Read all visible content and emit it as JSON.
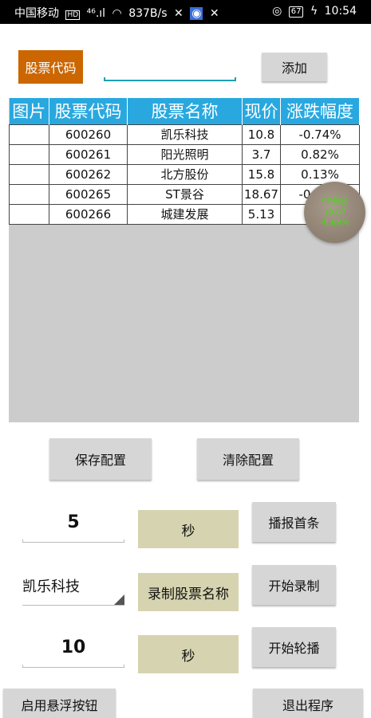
{
  "status_bar": {
    "carrier": "中国移动",
    "network": "⁴⁶.ıl",
    "speed": "837B/s",
    "battery": "67",
    "time": "10:54"
  },
  "top": {
    "code_label": "股票代码",
    "code_input_value": "",
    "add_button": "添加"
  },
  "table": {
    "headers": [
      "图片",
      "股票代码",
      "股票名称",
      "现价",
      "涨跌幅度"
    ],
    "rows": [
      {
        "image": "",
        "code": "600260",
        "name": "凯乐科技",
        "price": "10.8",
        "change": "-0.74%"
      },
      {
        "image": "",
        "code": "600261",
        "name": "阳光照明",
        "price": "3.7",
        "change": "0.82%"
      },
      {
        "image": "",
        "code": "600262",
        "name": "北方股份",
        "price": "15.8",
        "change": "0.13%"
      },
      {
        "image": "",
        "code": "600265",
        "name": "ST景谷",
        "price": "18.67",
        "change": "-0.69%"
      },
      {
        "image": "",
        "code": "600266",
        "name": "城建发展",
        "price": "5.13",
        "change": "0."
      }
    ]
  },
  "floating": {
    "name": "ST景谷",
    "price": "18.67",
    "change": "-0.69%",
    "text_color": "#39e600"
  },
  "config": {
    "save_button": "保存配置",
    "clear_button": "清除配置"
  },
  "controls": {
    "interval_value": "5",
    "interval_unit": "秒",
    "announce_first_button": "播报首条",
    "stock_select_value": "凯乐科技",
    "record_name_label": "录制股票名称",
    "start_record_button": "开始录制",
    "carousel_value": "10",
    "carousel_unit": "秒",
    "start_carousel_button": "开始轮播"
  },
  "bottom": {
    "enable_float_button": "启用悬浮按钮",
    "exit_button": "退出程序"
  },
  "colors": {
    "code_label_bg": "#cc6600",
    "header_bg": "#29a8e0",
    "tag_bg": "#d6d4b0",
    "button_bg": "#d6d6d6",
    "table_area_bg": "#cccccc"
  }
}
